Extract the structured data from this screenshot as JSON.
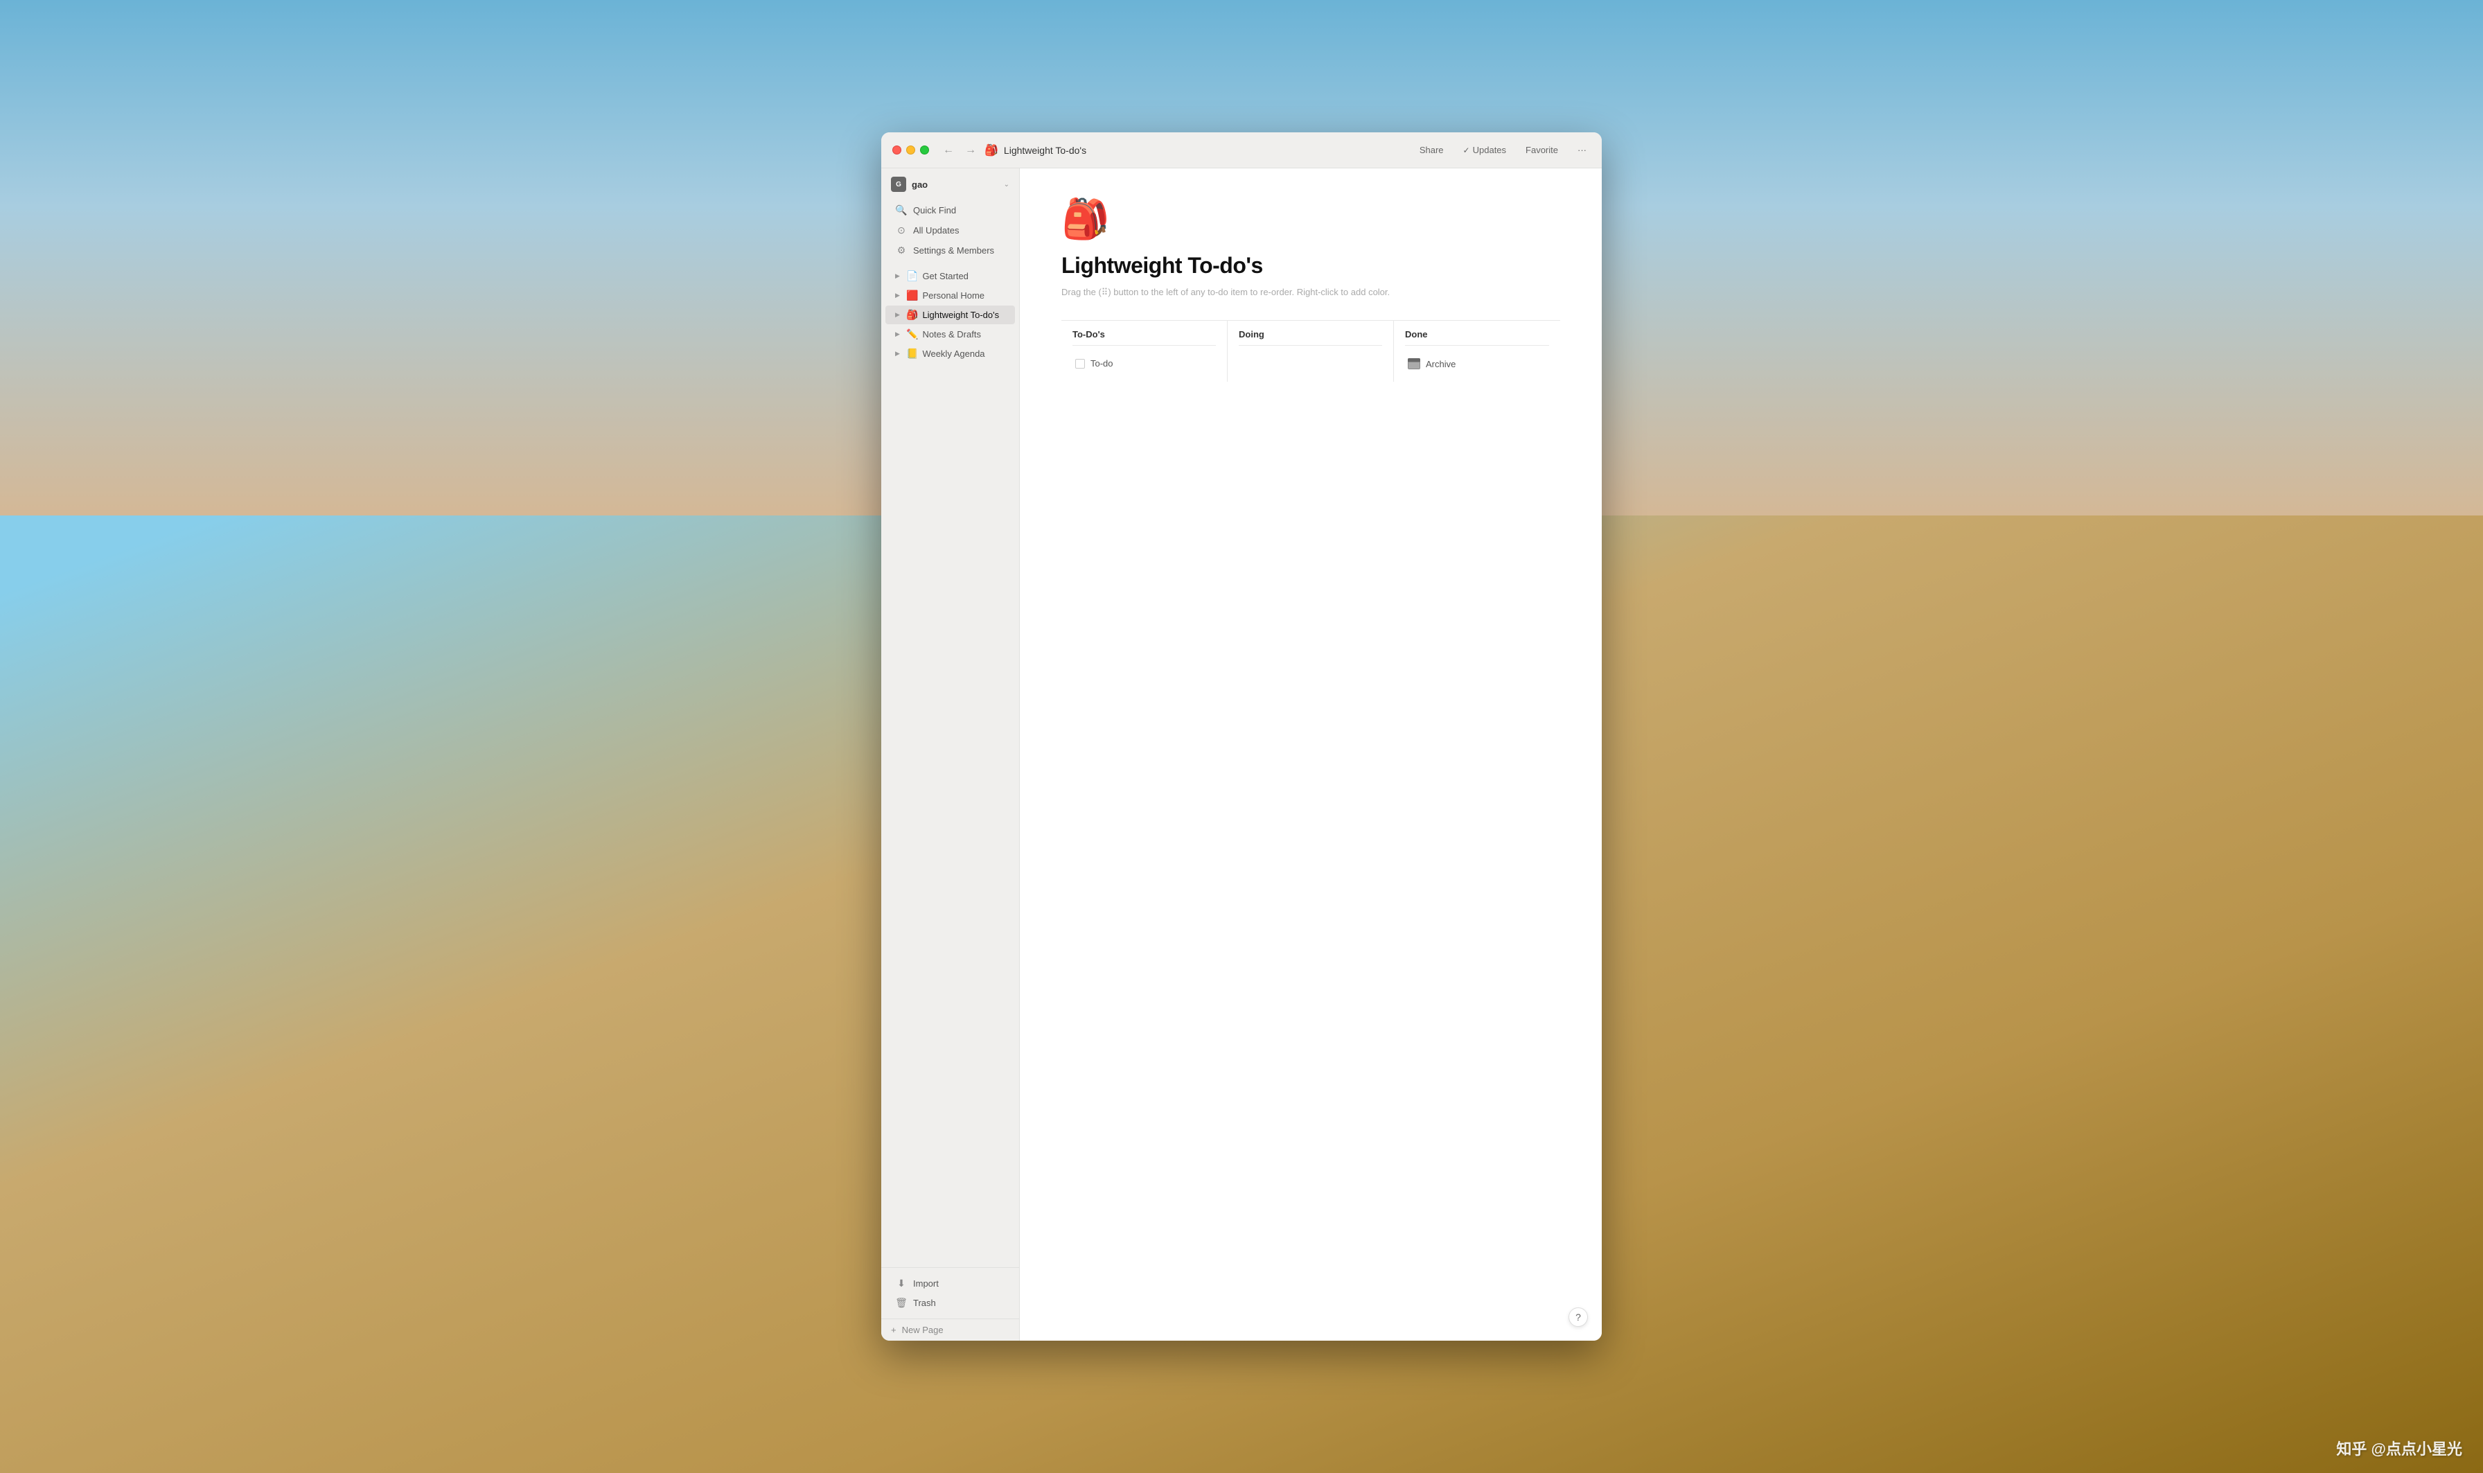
{
  "desktop": {
    "watermark": "知乎 @点点小星光"
  },
  "window": {
    "titlebar": {
      "back_btn": "←",
      "forward_btn": "→",
      "page_icon": "🎒",
      "title": "Lightweight To-do's",
      "share_label": "Share",
      "updates_label": "Updates",
      "updates_check": "✓",
      "favorite_label": "Favorite",
      "more_label": "···"
    },
    "sidebar": {
      "user": {
        "avatar": "G",
        "name": "gao",
        "chevron": "⌄"
      },
      "nav_items": [
        {
          "icon": "🔍",
          "label": "Quick Find"
        },
        {
          "icon": "⚙",
          "label": "All Updates"
        },
        {
          "icon": "⚙",
          "label": "Settings & Members"
        }
      ],
      "tree_items": [
        {
          "icon": "📄",
          "label": "Get Started",
          "chevron": "▶"
        },
        {
          "icon": "🟥",
          "label": "Personal Home",
          "chevron": "▶"
        },
        {
          "icon": "🎒",
          "label": "Lightweight To-do's",
          "chevron": "▶",
          "active": true
        },
        {
          "icon": "✏️",
          "label": "Notes & Drafts",
          "chevron": "▶"
        },
        {
          "icon": "📒",
          "label": "Weekly Agenda",
          "chevron": "▶"
        }
      ],
      "bottom_items": [
        {
          "icon": "⬇",
          "label": "Import"
        },
        {
          "icon": "🗑",
          "label": "Trash"
        }
      ],
      "new_page_plus": "+",
      "new_page_label": "New Page"
    },
    "page": {
      "emoji": "🎒",
      "title": "Lightweight To-do's",
      "hint": "Drag the (⠿) button to the left of any to-do item to re-order. Right-click to add color.",
      "columns": [
        {
          "header": "To-Do's",
          "cards": [
            {
              "type": "checkbox",
              "label": "To-do"
            }
          ]
        },
        {
          "header": "Doing",
          "cards": []
        },
        {
          "header": "Done",
          "cards": [
            {
              "type": "archive",
              "label": "Archive"
            }
          ]
        }
      ]
    },
    "help_btn": "?"
  }
}
